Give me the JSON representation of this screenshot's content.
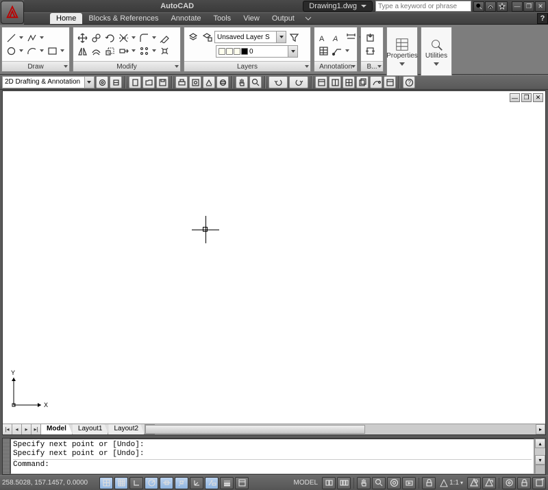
{
  "title": {
    "app": "AutoCAD",
    "document": "Drawing1.dwg",
    "search_placeholder": "Type a keyword or phrase"
  },
  "menu": {
    "tabs": [
      "Home",
      "Blocks & References",
      "Annotate",
      "Tools",
      "View",
      "Output"
    ],
    "active": "Home",
    "help": "?"
  },
  "ribbon": {
    "draw_label": "Draw",
    "modify_label": "Modify",
    "layers_label": "Layers",
    "annotation_label": "Annotation",
    "block_label": "B...",
    "properties_label": "Properties",
    "utilities_label": "Utilities",
    "layer_dropdown": "Unsaved Layer S",
    "layer_current": "0"
  },
  "workspace": {
    "selected": "2D Drafting & Annotation"
  },
  "layout_tabs": [
    "Model",
    "Layout1",
    "Layout2"
  ],
  "command": {
    "line1": "Specify next point or [Undo]:",
    "line2": "Specify next point or [Undo]:",
    "prompt": "Command:"
  },
  "status": {
    "coords": "258.5028, 157.1457, 0.0000",
    "model": "MODEL",
    "lock": "🔒",
    "scale": "1:1",
    "ucs_x": "X",
    "ucs_y": "Y"
  }
}
